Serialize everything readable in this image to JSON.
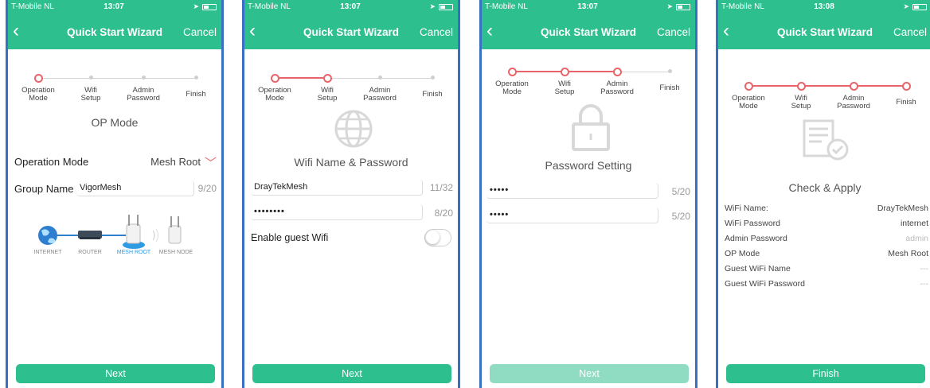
{
  "status": {
    "carrier": "T-Mobile NL",
    "times": [
      "13:07",
      "13:07",
      "13:07",
      "13:08"
    ]
  },
  "nav": {
    "title": "Quick Start Wizard",
    "cancel": "Cancel",
    "back_icon": "chevron-left-icon"
  },
  "steps": {
    "labels": [
      [
        "Operation",
        "Mode"
      ],
      [
        "Wifi",
        "Setup"
      ],
      [
        "Admin",
        "Password"
      ],
      [
        "Finish"
      ]
    ],
    "active_color": "#e8636a",
    "inactive_color": "#cfcfcf"
  },
  "accent": "#2ebf8f",
  "screen1": {
    "title": "OP Mode",
    "op_mode_label": "Operation Mode",
    "op_mode_value": "Mesh Root",
    "group_label": "Group Name",
    "group_value": "VigorMesh",
    "group_count": "9/20",
    "diagram_labels": [
      "INTERNET",
      "ROUTER",
      "MESH ROOT",
      "MESH NODE"
    ],
    "button": "Next"
  },
  "screen2": {
    "title": "Wifi Name & Password",
    "ssid_value": "DrayTekMesh",
    "ssid_count": "11/32",
    "password_value": "••••••••",
    "password_count": "8/20",
    "guest_label": "Enable guest Wifi",
    "guest_enabled": false,
    "button": "Next"
  },
  "screen3": {
    "title": "Password Setting",
    "pw1_value": "•••••",
    "pw1_count": "5/20",
    "pw2_value": "•••••",
    "pw2_count": "5/20",
    "button": "Next"
  },
  "screen4": {
    "title": "Check & Apply",
    "rows": [
      {
        "k": "WiFi Name:",
        "v": "DrayTekMesh"
      },
      {
        "k": "WiFi Password",
        "v": "internet"
      },
      {
        "k": "Admin Password",
        "v": "admin"
      },
      {
        "k": "OP Mode",
        "v": "Mesh Root"
      },
      {
        "k": "Guest WiFi Name",
        "v": "---"
      },
      {
        "k": "Guest WiFi Password",
        "v": "---"
      }
    ],
    "button": "Finish"
  }
}
